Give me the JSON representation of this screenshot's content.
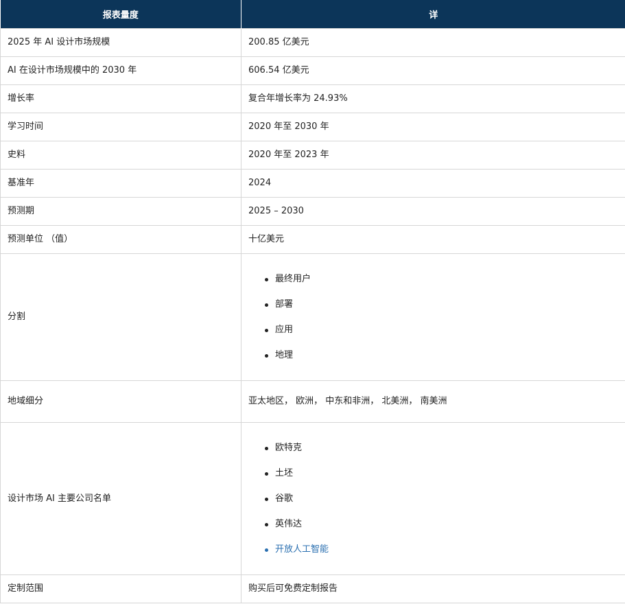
{
  "header": {
    "col1": "报表量度",
    "col2": "详"
  },
  "rows": [
    {
      "label": "2025 年 AI 设计市场规模",
      "value": "200.85 亿美元"
    },
    {
      "label": "AI 在设计市场规模中的 2030 年",
      "value": "606.54 亿美元"
    },
    {
      "label": "增长率",
      "value": "复合年增长率为 24.93%"
    },
    {
      "label": "学习时间",
      "value": "2020 年至 2030 年"
    },
    {
      "label": "史料",
      "value": "2020 年至 2023 年"
    },
    {
      "label": "基准年",
      "value": "2024"
    },
    {
      "label": "预测期",
      "value": "2025 – 2030"
    },
    {
      "label": "预测单位 （值）",
      "value": "十亿美元"
    }
  ],
  "segmentation": {
    "label": "分割",
    "items": [
      "最终用户",
      "部署",
      "应用",
      "地理"
    ]
  },
  "regional": {
    "label": "地域细分",
    "value": "亚太地区， 欧洲， 中东和非洲， 北美洲， 南美洲"
  },
  "companies": {
    "label": "设计市场 AI 主要公司名单",
    "items": [
      "欧特克",
      "土坯",
      "谷歌",
      "英伟达"
    ],
    "link_item": "开放人工智能"
  },
  "customization": {
    "label": "定制范围",
    "value": "购买后可免费定制报告"
  },
  "colors": {
    "header_bg": "#0c3559",
    "link": "#2a6fb0",
    "border": "#d6d6d6"
  }
}
